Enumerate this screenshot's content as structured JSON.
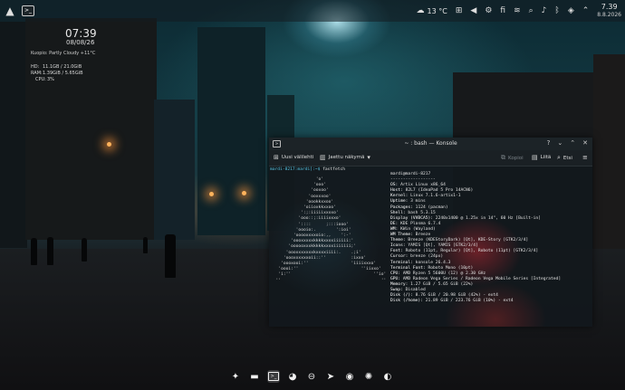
{
  "top_panel": {
    "weather_temp": "13 °C",
    "clock_time": "7.39",
    "clock_date": "8.8.2026",
    "tray_icons": [
      "menu-grid-icon",
      "volume-icon",
      "settings-icon",
      "finnish-text",
      "network-icon",
      "search-icon",
      "bell-icon",
      "bluetooth-icon",
      "shield-icon",
      "arrow-icon"
    ]
  },
  "desktop_widget": {
    "time": "07:39",
    "date": "08/08/26",
    "weather": "Kuopio: Partly Cloudy  +11°C",
    "hd": "HD:",
    "hd_value": "11.1GB / 21.0GiB",
    "ram": "RAM:",
    "ram_value": "1.39GiB / 5.65GiB",
    "cpu": "CPU:",
    "cpu_value": "3%"
  },
  "konsole": {
    "title": "~ : bash — Konsole",
    "toolbar": {
      "new_tab": "Uusi välilehti",
      "split_view": "Jaettu näkymä",
      "copy": "Kopioi",
      "paste": "Liitä",
      "find": "Etsi"
    },
    "prompt": "mardi-8217:",
    "prompt_path": "mardi]:~$",
    "command": " fastfetch",
    "logo_lines": [
      "                  'o'",
      "                 'ooo'",
      "                'ooxoo'",
      "               'ooxxxoo'",
      "              'oookkxxoo'",
      "             'oiioxkkxxoo'",
      "            ':;:iiiiixxxxo'",
      "           'ooo::;:iiiixxxo'",
      "           '::::      ;:::iooo'",
      "          'oooio:.        ':ioi'",
      "         'ooooxxxxoio:,,    ':-'",
      "        'oooxxxxxkkkkxxxxiiiiii:'",
      "       'oooooxxxkkkkkxxxxiiiiiii;'",
      "      'oooxxxxxxxkxxxxiiii:.    .;i'",
      "     'oooxxxxxxoii::''          :ixxo'",
      "    'oooxooi:''                 'iiiixxxo'",
      "   'oooi:''                         ''iixxo'",
      "   'i:''                                 ''io'",
      "  ''                                        ''"
    ],
    "info_lines": [
      {
        "k": "",
        "v": "mardi@mardi-8217"
      },
      {
        "k": "",
        "v": "------------------"
      },
      {
        "k": "OS: ",
        "v": "Artix Linux x86_64"
      },
      {
        "k": "Host: ",
        "v": "82L7 (IdeaPad 5 Pro 14ACN6)"
      },
      {
        "k": "Kernel: ",
        "v": "Linux 7.1.6-artix1-1"
      },
      {
        "k": "Uptime: ",
        "v": "3 mins"
      },
      {
        "k": "Packages: ",
        "v": "1124 (pacman)"
      },
      {
        "k": "Shell: ",
        "v": "bash 5.3.15"
      },
      {
        "k": "Display (VVBCA5): ",
        "v": "2240x1400 @ 1.25x in 14\", 60 Hz [Built-in]"
      },
      {
        "k": "DE: ",
        "v": "KDE Plasma 6.7.4"
      },
      {
        "k": "WM: ",
        "v": "KWin (Wayland)"
      },
      {
        "k": "WM Theme: ",
        "v": "Breeze"
      },
      {
        "k": "Theme: ",
        "v": "Breeze (KDEStoryDark) [Qt], KDE-Story [GTK2/3/4]"
      },
      {
        "k": "Icons: ",
        "v": "YAMIS [Qt], YAMIS [GTK2/3/4]"
      },
      {
        "k": "Font: ",
        "v": "Roboto (11pt, Regular) [Qt], Roboto (11pt) [GTK2/3/4]"
      },
      {
        "k": "Cursor: ",
        "v": "breeze (24px)"
      },
      {
        "k": "Terminal: ",
        "v": "konsole 26.4.3"
      },
      {
        "k": "Terminal Font: ",
        "v": "Roboto Mono (10pt)"
      },
      {
        "k": "CPU: ",
        "v": "AMD Ryzen 5 5600U (12) @ 2.30 GHz"
      },
      {
        "k": "GPU: ",
        "v": "AMD Radeon Vega Series / Radeon Vega Mobile Series [Integrated]"
      },
      {
        "k": "Memory: ",
        "v": "1.27 GiB / 5.65 GiB (22%)"
      },
      {
        "k": "Swap: ",
        "v": "Disabled"
      },
      {
        "k": "Disk (/): ",
        "v": "8.76 GiB / 20.98 GiB (42%) - ext4"
      },
      {
        "k": "Disk (/home): ",
        "v": "21.89 GiB / 223.76 GiB (10%) - ext4"
      }
    ]
  },
  "dock": {
    "items": [
      "plasma-icon",
      "file-manager-icon",
      "terminal-icon",
      "firefox-icon",
      "browser-icon",
      "telegram-icon",
      "steam-icon",
      "web-icon",
      "media-icon"
    ]
  }
}
